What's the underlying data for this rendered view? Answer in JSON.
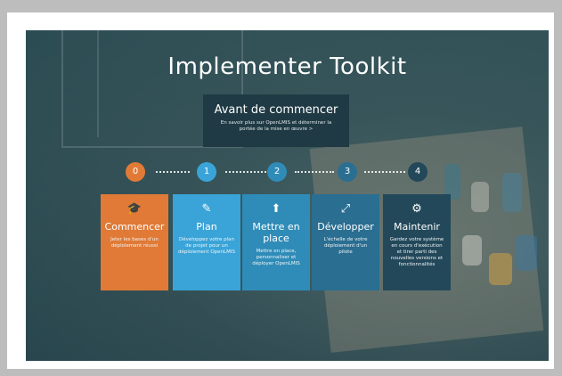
{
  "page": {
    "title": "Implementer Toolkit"
  },
  "intro": {
    "heading": "Avant de commencer",
    "text": "En savoir plus sur OpenLMIS et déterminer la portée de la mise en œuvre  >"
  },
  "steps": [
    {
      "number": "0",
      "color": "#e07a36"
    },
    {
      "number": "1",
      "color": "#3aa4d8"
    },
    {
      "number": "2",
      "color": "#2f8cb8"
    },
    {
      "number": "3",
      "color": "#2a6e92"
    },
    {
      "number": "4",
      "color": "#22485a"
    }
  ],
  "cards": [
    {
      "icon": "graduation-cap-icon",
      "glyph": "🎓",
      "title": "Commencer",
      "text": "Jeter les bases d'un déploiement réussi",
      "color": "#e07a36"
    },
    {
      "icon": "edit-icon",
      "glyph": "✎",
      "title": "Plan",
      "text": "Développez votre plan de projet pour un déploiement OpenLMIS",
      "color": "#3aa4d8"
    },
    {
      "icon": "upload-icon",
      "glyph": "⬆",
      "title": "Mettre en place",
      "text": "Mettre en place, personnaliser et déployer OpenLMIS",
      "color": "#2f8cb8"
    },
    {
      "icon": "expand-icon",
      "glyph": "⤢",
      "title": "Développer",
      "text": "L'échelle de votre déploiement d'un pilote",
      "color": "#2a6e92"
    },
    {
      "icon": "gear-icon",
      "glyph": "⚙",
      "title": "Maintenir",
      "text": "Gardez votre système en cours d'exécution et tirer parti des nouvelles versions et fonctionnalités",
      "color": "#22485a"
    }
  ]
}
